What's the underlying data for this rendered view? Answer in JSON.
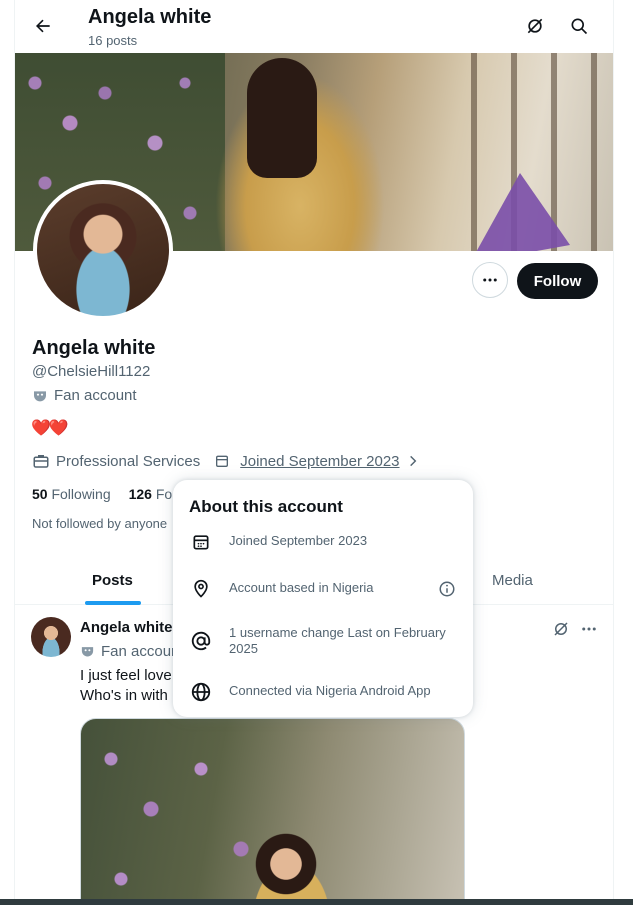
{
  "header": {
    "title": "Angela white",
    "post_count": "16 posts"
  },
  "profile": {
    "name": "Angela white",
    "handle": "@ChelsieHill1122",
    "account_type": "Fan account",
    "bio_emojis": "❤️❤️",
    "category": "Professional Services",
    "joined": "Joined September 2023",
    "following_count": "50",
    "following_label": "Following",
    "followers_count": "126",
    "followers_label": "Fo",
    "not_followed": "Not followed by anyone"
  },
  "actions": {
    "follow_label": "Follow"
  },
  "tabs": [
    {
      "label": "Posts",
      "active": true
    },
    {
      "label": "Media",
      "active": false
    }
  ],
  "post": {
    "author": "Angela white",
    "account_type": "Fan accoun",
    "line1": "I just feel love",
    "line2": "Who's in with"
  },
  "popup": {
    "title": "About this account",
    "rows": [
      {
        "icon": "calendar-icon",
        "text": "Joined September 2023"
      },
      {
        "icon": "location-pin-icon",
        "text": "Account based in Nigeria"
      },
      {
        "icon": "at-sign-icon",
        "text": "1 username change Last on February 2025"
      },
      {
        "icon": "globe-icon",
        "text": "Connected via Nigeria Android App"
      }
    ]
  },
  "colors": {
    "accent": "#1d9bf0",
    "text": "#0f1419",
    "secondary": "#536471",
    "follow_bg": "#0f1419"
  }
}
